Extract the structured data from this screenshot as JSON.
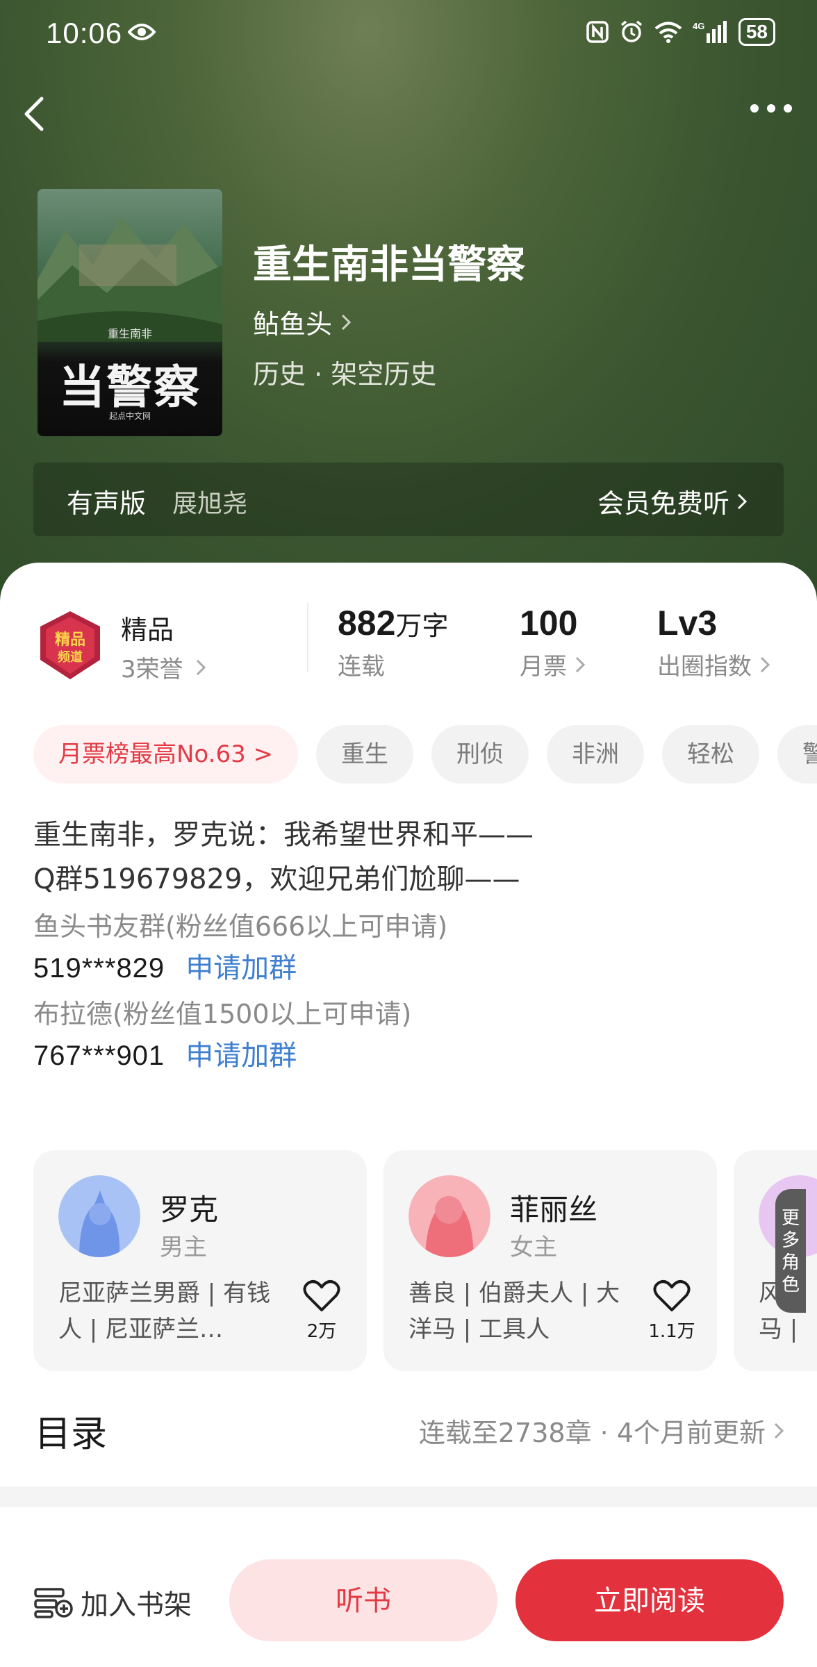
{
  "status_bar": {
    "time": "10:06",
    "battery": "58"
  },
  "book": {
    "title": "重生南非当警察",
    "author": "鲇鱼头",
    "genre": "历史 · 架空历史",
    "cover": {
      "small": "重生南非",
      "big": "当警察",
      "publisher": "起点中文网"
    }
  },
  "audio": {
    "label": "有声版",
    "narrator": "展旭尧",
    "free_listen": "会员免费听"
  },
  "quality": {
    "name": "精品",
    "honors": "3荣誉"
  },
  "stats": [
    {
      "value": "882",
      "unit": "万字",
      "label": "连载"
    },
    {
      "value": "100",
      "unit": "",
      "label": "月票"
    },
    {
      "value": "Lv3",
      "unit": "",
      "label": "出圈指数"
    }
  ],
  "tags": [
    "月票榜最高No.63 >",
    "重生",
    "刑侦",
    "非洲",
    "轻松",
    "警"
  ],
  "intro": {
    "line1": "重生南非，罗克说：我希望世界和平——",
    "line2": "Q群519679829，欢迎兄弟们尬聊——"
  },
  "groups": [
    {
      "name": "鱼头书友群(粉丝值666以上可申请)",
      "number": "519***829",
      "join": "申请加群"
    },
    {
      "name": "布拉德(粉丝值1500以上可申请)",
      "number": "767***901",
      "join": "申请加群"
    }
  ],
  "characters": [
    {
      "name": "罗克",
      "role": "男主",
      "desc": "尼亚萨兰男爵 | 有钱人 | 尼亚萨兰…",
      "likes": "2万"
    },
    {
      "name": "菲丽丝",
      "role": "女主",
      "desc": "善良 | 伯爵夫人 | 大洋马 | 工具人",
      "likes": "1.1万"
    },
    {
      "partial_desc": "风韵\n马 | 少"
    }
  ],
  "more_roles": "更多角色",
  "toc": {
    "title": "目录",
    "info": "连载至2738章 · 4个月前更新"
  },
  "bottom": {
    "shelf": "加入书架",
    "listen": "听书",
    "read": "立即阅读"
  },
  "colors": {
    "accent": "#e3323e",
    "link": "#3f7fcf",
    "hero": "#3a5530"
  }
}
